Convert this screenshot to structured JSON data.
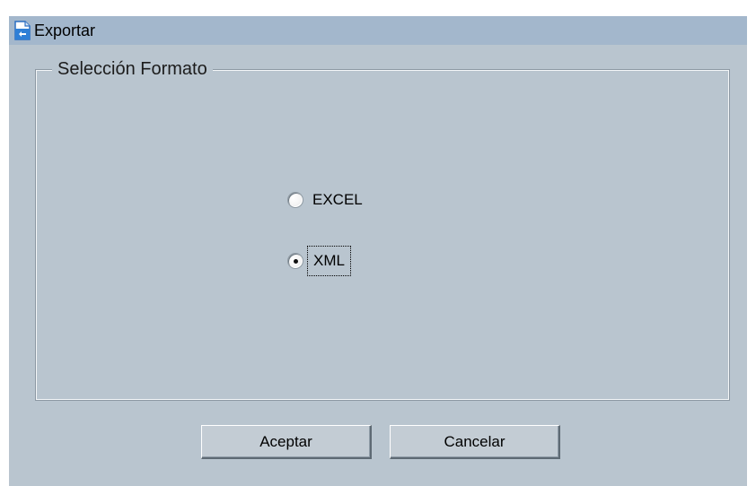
{
  "window": {
    "title": "Exportar",
    "icon": "export-document-icon"
  },
  "format_group": {
    "legend": "Selección Formato",
    "options": [
      {
        "label": "EXCEL",
        "selected": false
      },
      {
        "label": "XML",
        "selected": true
      }
    ]
  },
  "buttons": {
    "accept_label": "Aceptar",
    "cancel_label": "Cancelar"
  },
  "colors": {
    "titlebar": "#a3b7cc",
    "window_background": "#b9c5cf",
    "button_face": "#c3ccd4"
  }
}
